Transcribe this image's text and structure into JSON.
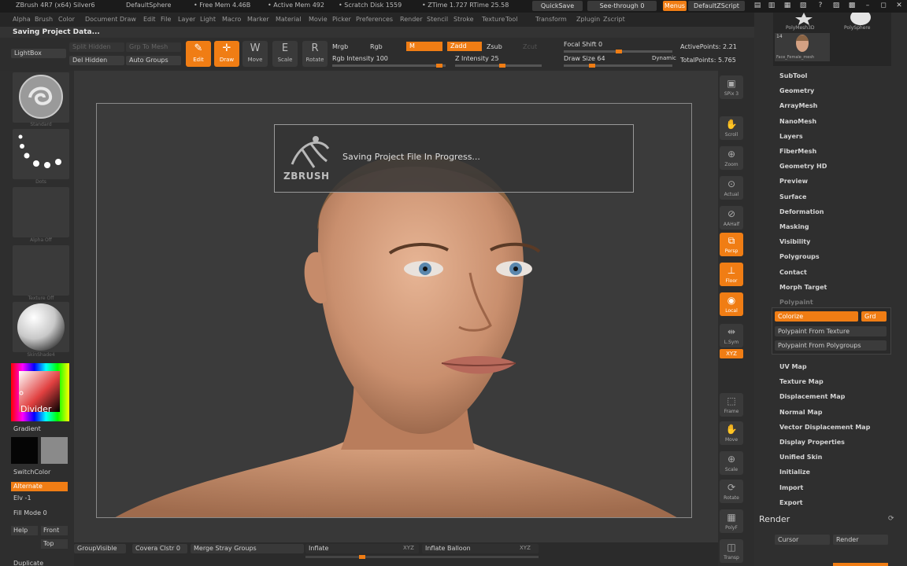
{
  "titlebar": {
    "app": "ZBrush 4R7 (x64) Silver6",
    "document": "DefaultSphere",
    "free_mem": "• Free Mem 4.46B",
    "active_mem": "• Active Mem 492",
    "scratch_disk": "• Scratch Disk 1559",
    "ztime": "• ZTime 1.727  RTime 25.58",
    "quicksave": "QuickSave",
    "seethrough": "See-through  0",
    "menus": "Menus",
    "script": "DefaultZScript"
  },
  "menubar": [
    "Alpha",
    "Brush",
    "Color",
    "Document",
    "Draw",
    "Edit",
    "File",
    "Layer",
    "Light",
    "Macro",
    "Marker",
    "Material",
    "Movie",
    "Picker",
    "Preferences",
    "Render",
    "Stencil",
    "Stroke",
    "Texture",
    "Tool",
    "Transform",
    "Zplugin",
    "Zscript"
  ],
  "status": "Saving Project Data...",
  "shelf": {
    "lightbox": "LightBox",
    "split_hidden": "Split Hidden",
    "grp_to_mesh": "Grp To Mesh",
    "del_hidden": "Del Hidden",
    "auto_groups": "Auto Groups",
    "tools": [
      {
        "label": "Edit",
        "glyph": "✎",
        "on": true
      },
      {
        "label": "Draw",
        "glyph": "✛",
        "on": true
      },
      {
        "label": "Move",
        "glyph": "W",
        "on": false
      },
      {
        "label": "Scale",
        "glyph": "E",
        "on": false
      },
      {
        "label": "Rotate",
        "glyph": "R",
        "on": false
      }
    ],
    "mrgb": "Mrgb",
    "rgb": "Rgb",
    "m": "M",
    "zadd": "Zadd",
    "zsub": "Zsub",
    "zcut": "Zcut",
    "rgb_intensity": "Rgb Intensity 100",
    "z_intensity": "Z Intensity 25",
    "focal_shift": "Focal Shift 0",
    "draw_size": "Draw Size 64",
    "dynamic": "Dynamic",
    "active_points": "ActivePoints: 2.21",
    "total_points": "TotalPoints: 5.765"
  },
  "leftshelf": {
    "brush_caption": "Standard",
    "stroke_caption": "Dots",
    "alpha_caption": "Alpha Off",
    "texture_caption": "Texture Off",
    "material_caption": "SkinShade4",
    "divider": "Divider",
    "gradient": "Gradient",
    "switchcolor": "SwitchColor",
    "alternate": "Alternate",
    "elv": "Elv -1",
    "fill_mode": "Fill Mode 0",
    "help": "Help",
    "front": "Front",
    "top": "Top",
    "duplicate": "Duplicate"
  },
  "dialog": {
    "message": "Saving Project File In Progress...",
    "logo_text": "ZBRUSH"
  },
  "rightstrip": [
    {
      "label": "SPix 3",
      "glyph": "▣",
      "on": false
    },
    {
      "label": "Scroll",
      "glyph": "✋",
      "on": false
    },
    {
      "label": "Zoom",
      "glyph": "⊕",
      "on": false
    },
    {
      "label": "Actual",
      "glyph": "⊙",
      "on": false
    },
    {
      "label": "AAHalf",
      "glyph": "⊘",
      "on": false
    },
    {
      "label": "Persp",
      "glyph": "⧉",
      "on": true
    },
    {
      "label": "Floor",
      "glyph": "⊥",
      "on": true
    },
    {
      "label": "Local",
      "glyph": "◉",
      "on": true
    },
    {
      "label": "L.Sym",
      "glyph": "⇹",
      "on": false
    },
    {
      "label": "Frame",
      "glyph": "⬚",
      "on": false
    },
    {
      "label": "Move",
      "glyph": "✋",
      "on": false
    },
    {
      "label": "Scale",
      "glyph": "⊕",
      "on": false
    },
    {
      "label": "Rotate",
      "glyph": "⟳",
      "on": false
    },
    {
      "label": "PolyF",
      "glyph": "▦",
      "on": false
    },
    {
      "label": "Transp",
      "glyph": "◫",
      "on": false
    }
  ],
  "xyz": "XYZ",
  "rightpanel": {
    "polymesh3d": "PolyMesh3D",
    "polysphere": "PolySphere",
    "thumb_count": "14",
    "face_tool": "Face_Female_mesh",
    "items_top": [
      "SubTool",
      "Geometry",
      "ArrayMesh",
      "NanoMesh",
      "Layers",
      "FiberMesh",
      "Geometry HD",
      "Preview",
      "Surface",
      "Deformation",
      "Masking",
      "Visibility",
      "Polygroups",
      "Contact",
      "Morph Target"
    ],
    "polypaint": "Polypaint",
    "colorize": "Colorize",
    "grd": "Grd",
    "pp_from_texture": "Polypaint From Texture",
    "pp_from_polygroups": "Polypaint From Polygroups",
    "items_bottom": [
      "UV Map",
      "Texture Map",
      "Displacement Map",
      "Normal Map",
      "Vector Displacement Map",
      "Display Properties",
      "Unified Skin",
      "Initialize",
      "Import",
      "Export"
    ],
    "render": "Render",
    "cursor": "Cursor",
    "render_btn": "Render"
  },
  "bottombar": {
    "groupvisible": "GroupVisible",
    "coverage": "Covera  Clstr 0",
    "merge_stray": "Merge Stray Groups",
    "inflate": "Inflate",
    "xyz1": "XYZ",
    "inflate_balloon": "Inflate Balloon",
    "xyz2": "XYZ"
  },
  "colors": {
    "accent": "#f07d14",
    "panel": "#2f2f2f",
    "canvas": "#3b3b3b"
  }
}
